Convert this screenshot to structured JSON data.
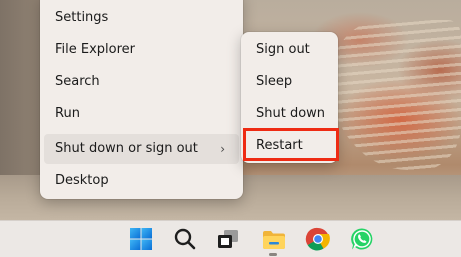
{
  "context_menu": {
    "items": [
      {
        "label": "Settings"
      },
      {
        "label": "File Explorer"
      },
      {
        "label": "Search"
      },
      {
        "label": "Run"
      },
      {
        "label": "Shut down or sign out",
        "has_submenu": true,
        "chevron": "›"
      },
      {
        "label": "Desktop"
      }
    ]
  },
  "submenu": {
    "items": [
      {
        "label": "Sign out"
      },
      {
        "label": "Sleep"
      },
      {
        "label": "Shut down"
      },
      {
        "label": "Restart",
        "highlighted": true
      }
    ]
  },
  "highlight_color": "#ee2b13",
  "taskbar": {
    "icons": [
      {
        "name": "windows-start-icon"
      },
      {
        "name": "search-icon"
      },
      {
        "name": "task-view-icon"
      },
      {
        "name": "file-explorer-icon",
        "running": true
      },
      {
        "name": "chrome-icon"
      },
      {
        "name": "whatsapp-icon"
      }
    ]
  }
}
